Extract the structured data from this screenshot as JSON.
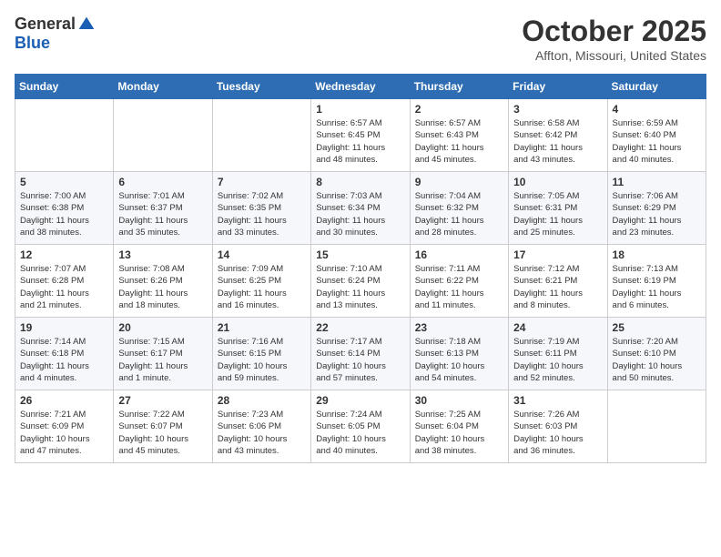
{
  "header": {
    "logo_general": "General",
    "logo_blue": "Blue",
    "month_title": "October 2025",
    "location": "Affton, Missouri, United States"
  },
  "calendar": {
    "days_of_week": [
      "Sunday",
      "Monday",
      "Tuesday",
      "Wednesday",
      "Thursday",
      "Friday",
      "Saturday"
    ],
    "weeks": [
      [
        {
          "day": "",
          "info": ""
        },
        {
          "day": "",
          "info": ""
        },
        {
          "day": "",
          "info": ""
        },
        {
          "day": "1",
          "info": "Sunrise: 6:57 AM\nSunset: 6:45 PM\nDaylight: 11 hours\nand 48 minutes."
        },
        {
          "day": "2",
          "info": "Sunrise: 6:57 AM\nSunset: 6:43 PM\nDaylight: 11 hours\nand 45 minutes."
        },
        {
          "day": "3",
          "info": "Sunrise: 6:58 AM\nSunset: 6:42 PM\nDaylight: 11 hours\nand 43 minutes."
        },
        {
          "day": "4",
          "info": "Sunrise: 6:59 AM\nSunset: 6:40 PM\nDaylight: 11 hours\nand 40 minutes."
        }
      ],
      [
        {
          "day": "5",
          "info": "Sunrise: 7:00 AM\nSunset: 6:38 PM\nDaylight: 11 hours\nand 38 minutes."
        },
        {
          "day": "6",
          "info": "Sunrise: 7:01 AM\nSunset: 6:37 PM\nDaylight: 11 hours\nand 35 minutes."
        },
        {
          "day": "7",
          "info": "Sunrise: 7:02 AM\nSunset: 6:35 PM\nDaylight: 11 hours\nand 33 minutes."
        },
        {
          "day": "8",
          "info": "Sunrise: 7:03 AM\nSunset: 6:34 PM\nDaylight: 11 hours\nand 30 minutes."
        },
        {
          "day": "9",
          "info": "Sunrise: 7:04 AM\nSunset: 6:32 PM\nDaylight: 11 hours\nand 28 minutes."
        },
        {
          "day": "10",
          "info": "Sunrise: 7:05 AM\nSunset: 6:31 PM\nDaylight: 11 hours\nand 25 minutes."
        },
        {
          "day": "11",
          "info": "Sunrise: 7:06 AM\nSunset: 6:29 PM\nDaylight: 11 hours\nand 23 minutes."
        }
      ],
      [
        {
          "day": "12",
          "info": "Sunrise: 7:07 AM\nSunset: 6:28 PM\nDaylight: 11 hours\nand 21 minutes."
        },
        {
          "day": "13",
          "info": "Sunrise: 7:08 AM\nSunset: 6:26 PM\nDaylight: 11 hours\nand 18 minutes."
        },
        {
          "day": "14",
          "info": "Sunrise: 7:09 AM\nSunset: 6:25 PM\nDaylight: 11 hours\nand 16 minutes."
        },
        {
          "day": "15",
          "info": "Sunrise: 7:10 AM\nSunset: 6:24 PM\nDaylight: 11 hours\nand 13 minutes."
        },
        {
          "day": "16",
          "info": "Sunrise: 7:11 AM\nSunset: 6:22 PM\nDaylight: 11 hours\nand 11 minutes."
        },
        {
          "day": "17",
          "info": "Sunrise: 7:12 AM\nSunset: 6:21 PM\nDaylight: 11 hours\nand 8 minutes."
        },
        {
          "day": "18",
          "info": "Sunrise: 7:13 AM\nSunset: 6:19 PM\nDaylight: 11 hours\nand 6 minutes."
        }
      ],
      [
        {
          "day": "19",
          "info": "Sunrise: 7:14 AM\nSunset: 6:18 PM\nDaylight: 11 hours\nand 4 minutes."
        },
        {
          "day": "20",
          "info": "Sunrise: 7:15 AM\nSunset: 6:17 PM\nDaylight: 11 hours\nand 1 minute."
        },
        {
          "day": "21",
          "info": "Sunrise: 7:16 AM\nSunset: 6:15 PM\nDaylight: 10 hours\nand 59 minutes."
        },
        {
          "day": "22",
          "info": "Sunrise: 7:17 AM\nSunset: 6:14 PM\nDaylight: 10 hours\nand 57 minutes."
        },
        {
          "day": "23",
          "info": "Sunrise: 7:18 AM\nSunset: 6:13 PM\nDaylight: 10 hours\nand 54 minutes."
        },
        {
          "day": "24",
          "info": "Sunrise: 7:19 AM\nSunset: 6:11 PM\nDaylight: 10 hours\nand 52 minutes."
        },
        {
          "day": "25",
          "info": "Sunrise: 7:20 AM\nSunset: 6:10 PM\nDaylight: 10 hours\nand 50 minutes."
        }
      ],
      [
        {
          "day": "26",
          "info": "Sunrise: 7:21 AM\nSunset: 6:09 PM\nDaylight: 10 hours\nand 47 minutes."
        },
        {
          "day": "27",
          "info": "Sunrise: 7:22 AM\nSunset: 6:07 PM\nDaylight: 10 hours\nand 45 minutes."
        },
        {
          "day": "28",
          "info": "Sunrise: 7:23 AM\nSunset: 6:06 PM\nDaylight: 10 hours\nand 43 minutes."
        },
        {
          "day": "29",
          "info": "Sunrise: 7:24 AM\nSunset: 6:05 PM\nDaylight: 10 hours\nand 40 minutes."
        },
        {
          "day": "30",
          "info": "Sunrise: 7:25 AM\nSunset: 6:04 PM\nDaylight: 10 hours\nand 38 minutes."
        },
        {
          "day": "31",
          "info": "Sunrise: 7:26 AM\nSunset: 6:03 PM\nDaylight: 10 hours\nand 36 minutes."
        },
        {
          "day": "",
          "info": ""
        }
      ]
    ]
  }
}
